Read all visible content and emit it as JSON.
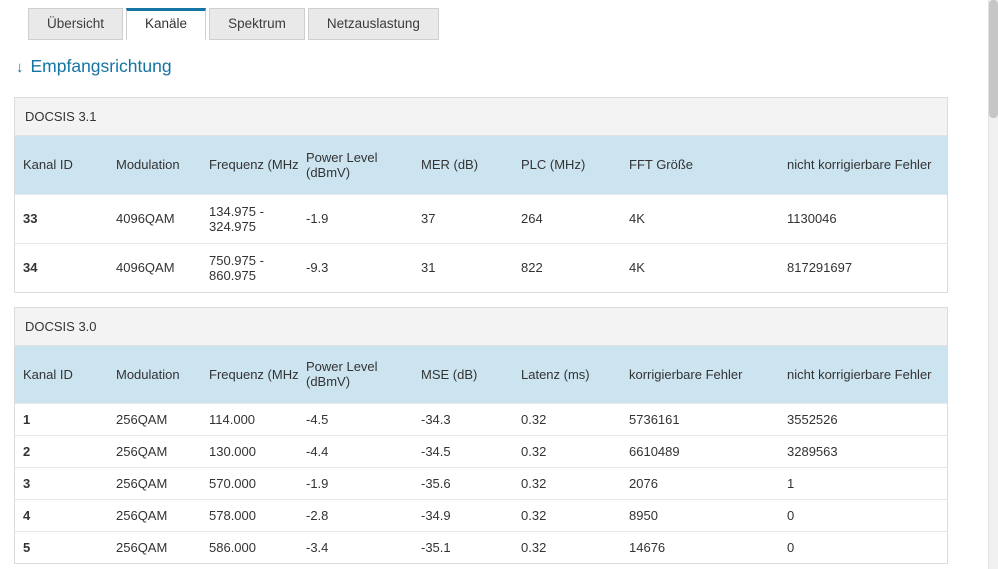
{
  "tabs": {
    "items": [
      {
        "label": "Übersicht",
        "active": false
      },
      {
        "label": "Kanäle",
        "active": true
      },
      {
        "label": "Spektrum",
        "active": false
      },
      {
        "label": "Netzauslastung",
        "active": false
      }
    ]
  },
  "section_heading": {
    "arrow": "↓",
    "label": "Empfangsrichtung"
  },
  "colors": {
    "accent_blue": "#1474a4",
    "header_row_bg": "#cce3f0",
    "group_header_bg": "#f3f3f3"
  },
  "tables": [
    {
      "group_title": "DOCSIS 3.1",
      "headers": [
        "Kanal ID",
        "Modulation",
        "Frequenz (MHz)",
        "Power Level (dBmV)",
        "MER (dB)",
        "PLC (MHz)",
        "FFT Größe",
        "nicht korrigierbare Fehler"
      ],
      "rows": [
        [
          "33",
          "4096QAM",
          "134.975 - 324.975",
          "-1.9",
          "37",
          "264",
          "4K",
          "1130046"
        ],
        [
          "34",
          "4096QAM",
          "750.975 - 860.975",
          "-9.3",
          "31",
          "822",
          "4K",
          "817291697"
        ]
      ]
    },
    {
      "group_title": "DOCSIS 3.0",
      "headers": [
        "Kanal ID",
        "Modulation",
        "Frequenz (MHz)",
        "Power Level (dBmV)",
        "MSE (dB)",
        "Latenz (ms)",
        "korrigierbare Fehler",
        "nicht korrigierbare Fehler"
      ],
      "rows": [
        [
          "1",
          "256QAM",
          "114.000",
          "-4.5",
          "-34.3",
          "0.32",
          "5736161",
          "3552526"
        ],
        [
          "2",
          "256QAM",
          "130.000",
          "-4.4",
          "-34.5",
          "0.32",
          "6610489",
          "3289563"
        ],
        [
          "3",
          "256QAM",
          "570.000",
          "-1.9",
          "-35.6",
          "0.32",
          "2076",
          "1"
        ],
        [
          "4",
          "256QAM",
          "578.000",
          "-2.8",
          "-34.9",
          "0.32",
          "8950",
          "0"
        ],
        [
          "5",
          "256QAM",
          "586.000",
          "-3.4",
          "-35.1",
          "0.32",
          "14676",
          "0"
        ]
      ]
    }
  ]
}
